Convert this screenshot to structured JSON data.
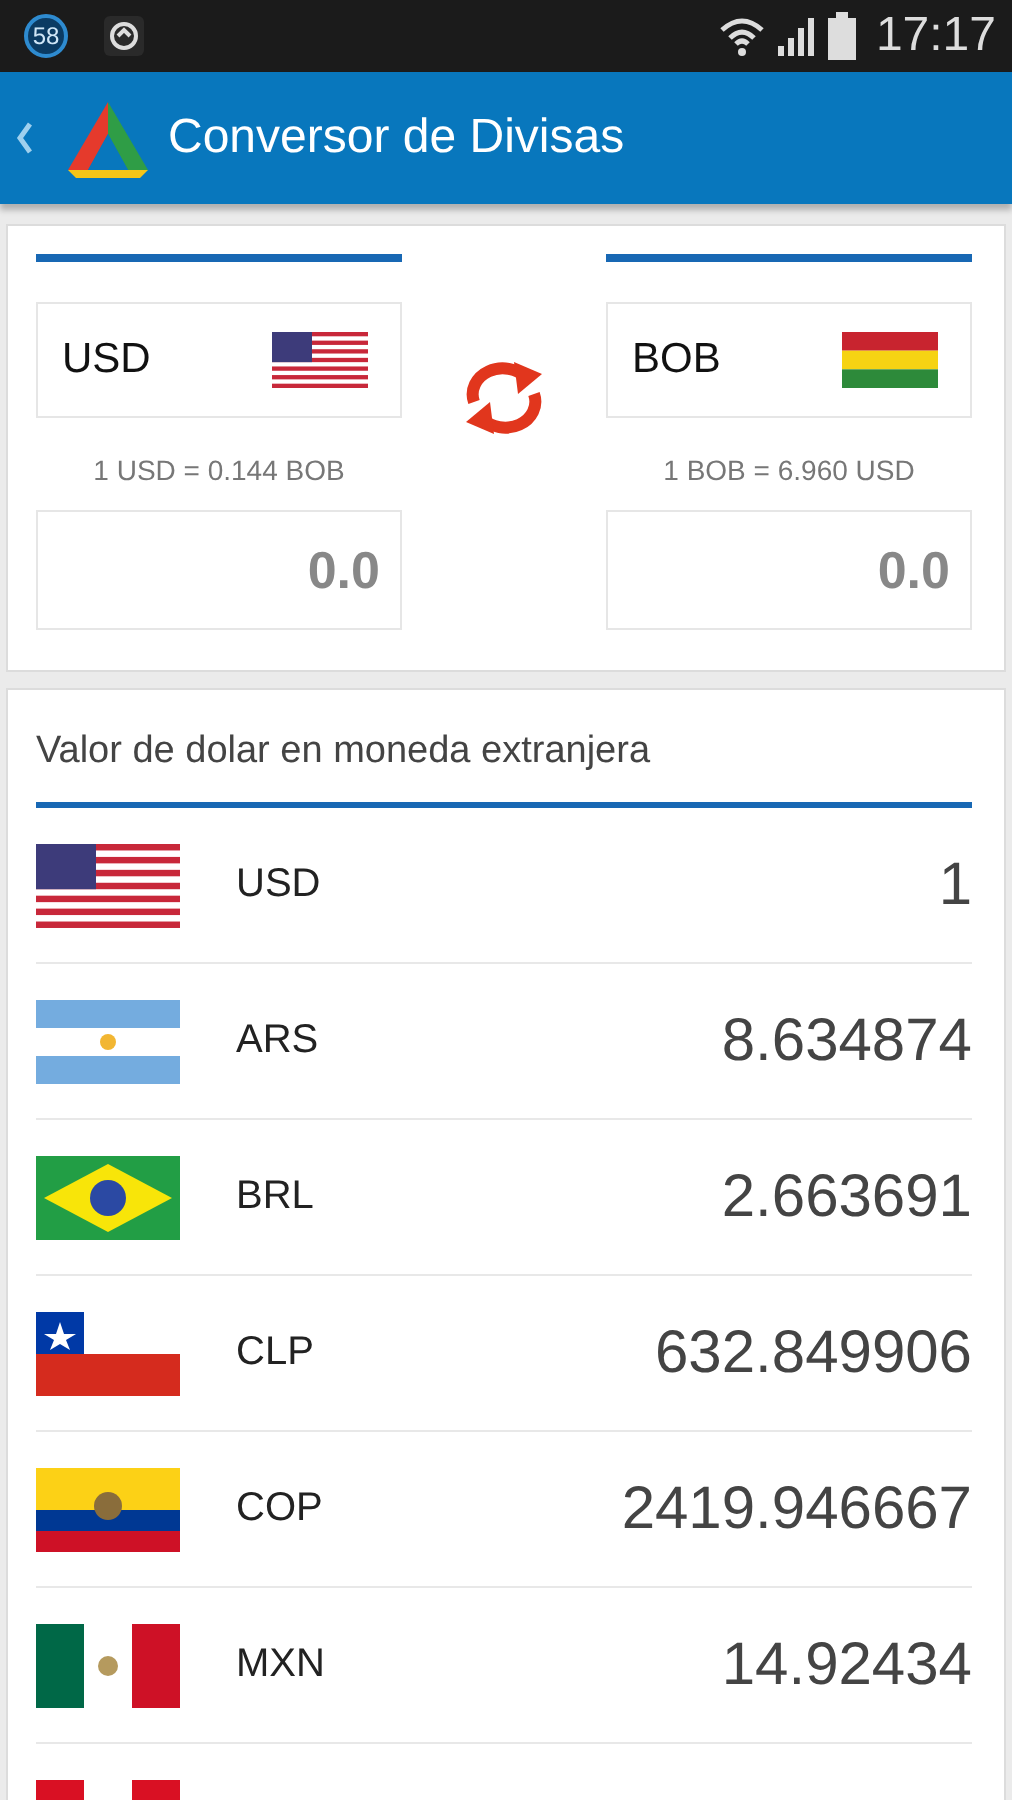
{
  "status_bar": {
    "badge": "58",
    "time": "17:17"
  },
  "app_bar": {
    "title": "Conversor de Divisas"
  },
  "converter": {
    "from": {
      "code": "USD",
      "kind": "usa",
      "rate": "1 USD = 0.144 BOB",
      "amount": "0.0"
    },
    "to": {
      "code": "BOB",
      "kind": "bolivia",
      "rate": "1 BOB = 6.960 USD",
      "amount": "0.0"
    }
  },
  "rates": {
    "title": "Valor de dolar en moneda extranjera",
    "rows": [
      {
        "kind": "usa",
        "code": "USD",
        "value": "1"
      },
      {
        "kind": "argentina",
        "code": "ARS",
        "value": "8.634874"
      },
      {
        "kind": "brazil",
        "code": "BRL",
        "value": "2.663691"
      },
      {
        "kind": "chile",
        "code": "CLP",
        "value": "632.849906"
      },
      {
        "kind": "colombia",
        "code": "COP",
        "value": "2419.946667"
      },
      {
        "kind": "mexico",
        "code": "MXN",
        "value": "14.92434"
      },
      {
        "kind": "peru"
      }
    ]
  }
}
